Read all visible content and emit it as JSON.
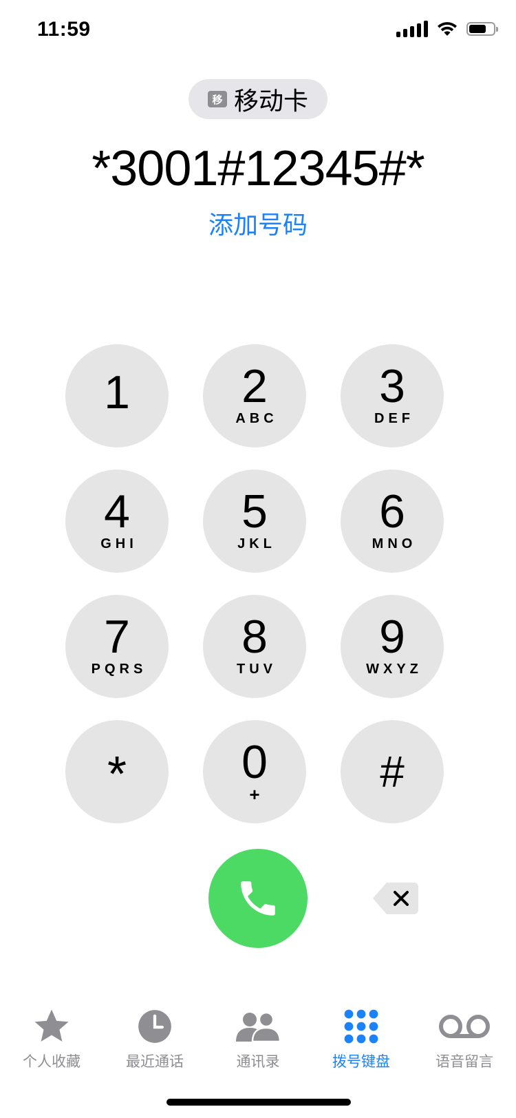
{
  "status_bar": {
    "time": "11:59",
    "battery_level": 0.7
  },
  "sim": {
    "badge": "移",
    "label": "移动卡"
  },
  "dialed_number": "*3001#12345#*",
  "add_number_label": "添加号码",
  "keypad": [
    {
      "digit": "1",
      "letters": ""
    },
    {
      "digit": "2",
      "letters": "ABC"
    },
    {
      "digit": "3",
      "letters": "DEF"
    },
    {
      "digit": "4",
      "letters": "GHI"
    },
    {
      "digit": "5",
      "letters": "JKL"
    },
    {
      "digit": "6",
      "letters": "MNO"
    },
    {
      "digit": "7",
      "letters": "PQRS"
    },
    {
      "digit": "8",
      "letters": "TUV"
    },
    {
      "digit": "9",
      "letters": "WXYZ"
    },
    {
      "digit": "*",
      "letters": ""
    },
    {
      "digit": "0",
      "letters": "+"
    },
    {
      "digit": "#",
      "letters": ""
    }
  ],
  "tabs": [
    {
      "label": "个人收藏",
      "icon": "star-icon",
      "active": false
    },
    {
      "label": "最近通话",
      "icon": "clock-icon",
      "active": false
    },
    {
      "label": "通讯录",
      "icon": "contacts-icon",
      "active": false
    },
    {
      "label": "拨号键盘",
      "icon": "keypad-icon",
      "active": true
    },
    {
      "label": "语音留言",
      "icon": "voicemail-icon",
      "active": false
    }
  ],
  "colors": {
    "accent": "#1a82fb",
    "call_green": "#4cd964",
    "key_bg": "#e5e5e5",
    "inactive": "#8e8e93"
  }
}
